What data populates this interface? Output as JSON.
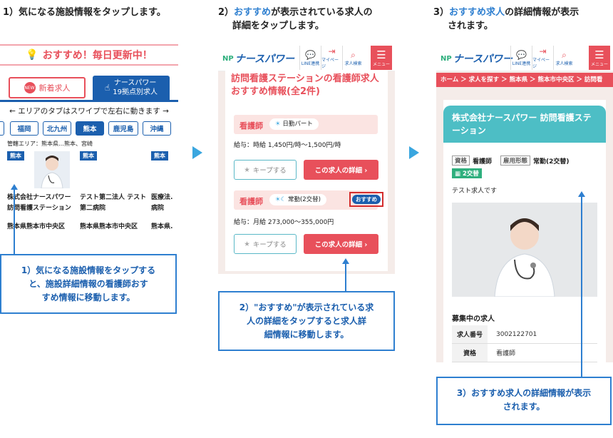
{
  "steps": {
    "s1": "1）気になる施設情報をタップします。",
    "s2_num": "2）",
    "s2_hl": "おすすめ",
    "s2_rest_line1": "が表示されている求人の",
    "s2_line2": "詳細をタップします。",
    "s3_num": "3）",
    "s3_hl": "おすすめ求人",
    "s3_rest_line1": "の詳細情報が表示",
    "s3_line2": "されます。"
  },
  "panel1": {
    "banner": "おすすめ！毎日更新中！",
    "tab_new": "新着求人",
    "tab_19_line1": "ナースパワー",
    "tab_19_line2": "19拠点別求人",
    "swipe_hint": "← エリアのタブはスワイプで左右に動きます →",
    "areas": [
      "福岡",
      "北九州",
      "熊本",
      "鹿児島",
      "沖縄"
    ],
    "selected_area": "熊本",
    "jurisdiction": "管轄エリア：熊本県…熊本、宮崎",
    "cards": [
      {
        "tag": "熊本",
        "facility_line1": "株式会社ナースパワー",
        "facility_line2": "訪問看護ステーション",
        "location": "熊本県熊本市中央区"
      },
      {
        "tag": "熊本",
        "facility_line1": "テスト第二法人 テスト",
        "facility_line2": "第二病院",
        "location": "熊本県熊本市中央区"
      },
      {
        "tag": "熊本",
        "facility_line1": "医療法.",
        "facility_line2": "病院",
        "location": "熊本県."
      }
    ],
    "callout": [
      "1）気になる施設情報をタップする",
      "と、施設詳細情報の看護師おす",
      "すめ情報に移動します。"
    ]
  },
  "header": {
    "logo_np": "NP",
    "logo_text": "ナースパワー",
    "icons": [
      {
        "icon": "line-chat-icon",
        "label": "LINE連携"
      },
      {
        "icon": "login-icon",
        "label": "マイページ"
      },
      {
        "icon": "search-icon",
        "label": "求人検索"
      }
    ],
    "menu_label": "メニュー"
  },
  "panel2": {
    "title_line1": "訪問看護ステーションの看護師求人",
    "title_line2": "おすすめ情報(全2件)",
    "jobs": [
      {
        "type": "看護師",
        "shift": "日勤パート",
        "salary": "給与：時給 1,450円/時〜1,500円/時",
        "keep": "キープする",
        "detail": "この求人の詳細 ›",
        "recommended": false
      },
      {
        "type": "看護師",
        "shift": "常勤(2交替)",
        "salary": "給与：月給 273,000〜355,000円",
        "keep": "キープする",
        "detail": "この求人の詳細 ›",
        "recommended": true
      }
    ],
    "osusume_badge": "おすすめ",
    "callout": [
      "2）\"おすすめ\"が表示されている求",
      "人の詳細をタップすると求人詳",
      "細情報に移動します。"
    ]
  },
  "panel3": {
    "breadcrumb": "ホーム ＞ 求人を探す ＞ 熊本県 ＞ 熊本市中央区 ＞ 訪問看",
    "header_line1": "株式会社ナースパワー 訪問看護ステ",
    "header_line2": "ーション",
    "qual_label": "資格",
    "qual_value": "看護師",
    "emp_label": "雇用形態",
    "emp_value": "常勤(2交替)",
    "shift_badge": "2交替",
    "desc": "テスト求人です",
    "section": "募集中の求人",
    "rows": [
      {
        "key": "求人番号",
        "value": "3002122701"
      },
      {
        "key": "資格",
        "value": "看護師"
      }
    ],
    "callout": [
      "3）おすすめ求人の詳細情報が表示",
      "されます。"
    ]
  },
  "colors": {
    "accent_red": "#e8505b",
    "brand_blue": "#1b5fae",
    "teal": "#4dbec5",
    "link_blue": "#2e7fd0"
  }
}
